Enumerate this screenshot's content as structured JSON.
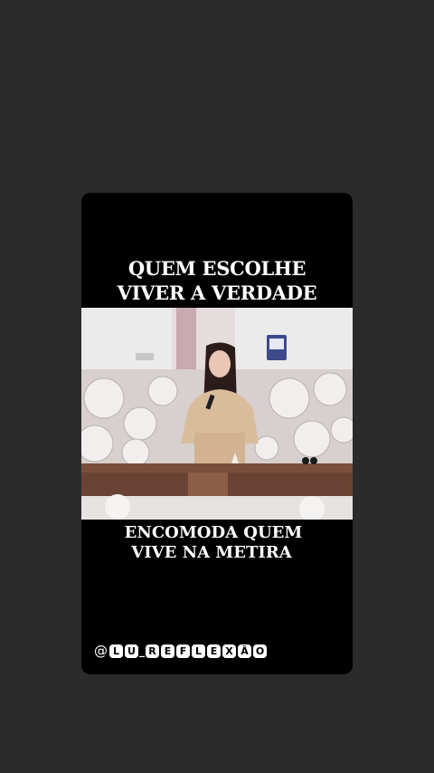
{
  "story": {
    "caption_top": [
      "QUEM ESCOLHE",
      "VIVER A VERDADE"
    ],
    "caption_bottom": [
      "ENCOMODA QUEM",
      "VIVE NA METIRA"
    ],
    "handle": {
      "at": "@",
      "chars": [
        "L",
        "U",
        "_",
        "R",
        "E",
        "F",
        "L",
        "E",
        "X",
        "Ã",
        "O"
      ]
    }
  },
  "colors": {
    "page_background": "#2b2b2b",
    "card_background": "#000000",
    "caption_text": "#ffffff"
  }
}
